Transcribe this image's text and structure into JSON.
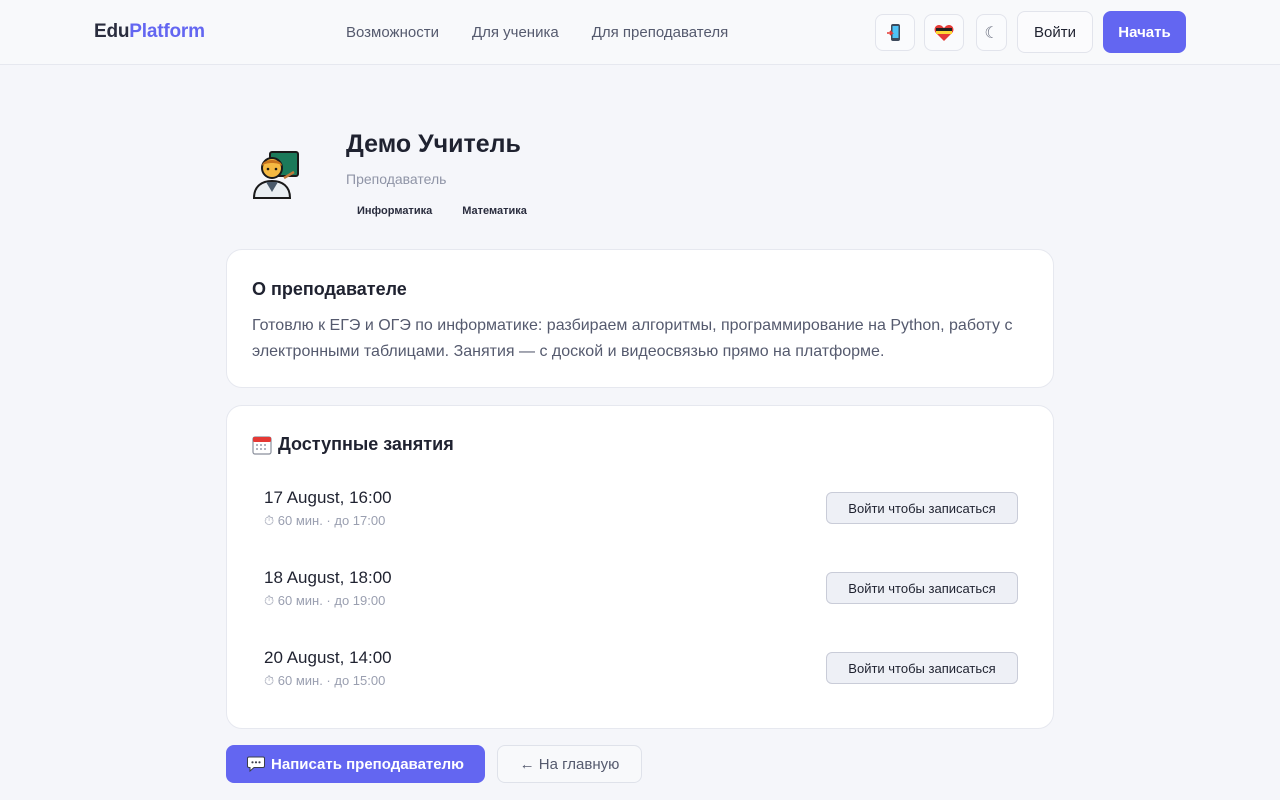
{
  "header": {
    "logo_part1": "Edu",
    "logo_part2": "Platform",
    "nav": [
      "Возможности",
      "Для ученика",
      "Для преподавателя"
    ],
    "icons": [
      "mobile-phone-icon",
      "heart-icon",
      "moon-icon"
    ],
    "moon_glyph": "☾",
    "login_label": "Войти",
    "start_label": "Начать",
    "accent": "#6366f1"
  },
  "profile": {
    "avatar_icon": "teacher-icon",
    "name": "Демо Учитель",
    "role": "Преподаватель",
    "tags": [
      "Информатика",
      "Математика"
    ]
  },
  "about": {
    "title": "О преподавателе",
    "text": "Готовлю к ЕГЭ и ОГЭ по информатике: разбираем алгоритмы, программирование на Python, работу с электронными таблицами. Занятия — с доской и видеосвязью прямо на платформе."
  },
  "slots": {
    "title": "Доступные занятия",
    "title_icon": "calendar-icon",
    "items": [
      {
        "date": "17 August, 16:00",
        "meta": "⏱ 60 мин. · до 17:00",
        "button": "Войти чтобы записаться"
      },
      {
        "date": "18 August, 18:00",
        "meta": "⏱ 60 мин. · до 19:00",
        "button": "Войти чтобы записаться"
      },
      {
        "date": "20 August, 14:00",
        "meta": "⏱ 60 мин. · до 15:00",
        "button": "Войти чтобы записаться"
      }
    ]
  },
  "actions": {
    "message_label": "Написать преподавателю",
    "message_icon": "speech-bubble-icon",
    "home_label": "← На главную"
  }
}
